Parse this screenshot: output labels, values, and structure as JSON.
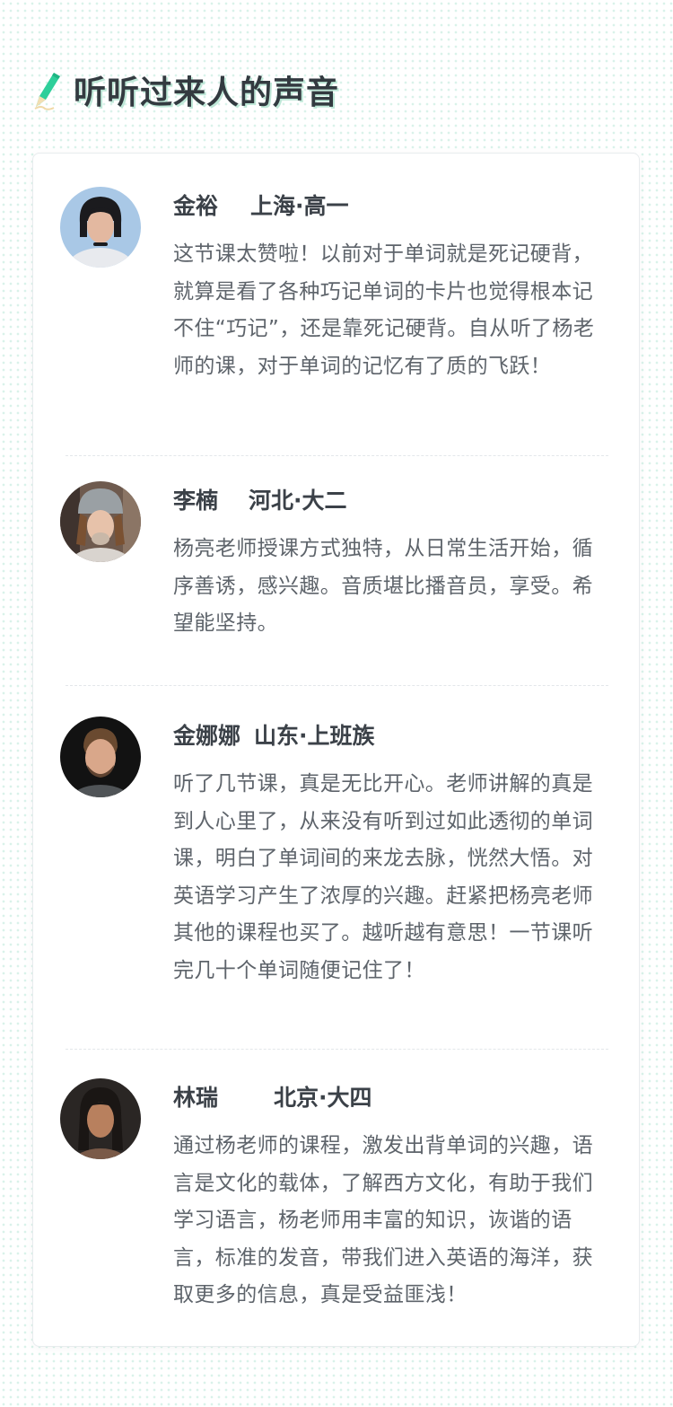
{
  "header": {
    "title": "听听过来人的声音",
    "icon": "pencil-icon"
  },
  "colors": {
    "accent": "#2ecf9a",
    "title_shadow": "#bfe8d8",
    "text": "#5e646b"
  },
  "reviews": [
    {
      "name": "金裕",
      "location": "上海·高一",
      "quote": "这节课太赞啦！以前对于单词就是死记硬背，就算是看了各种巧记单词的卡片也觉得根本记不住“巧记”，还是靠死记硬背。自从听了杨老师的课，对于单词的记忆有了质的飞跃！",
      "avatar": "avatar-photo"
    },
    {
      "name": "李楠",
      "location": "河北·大二",
      "quote": "杨亮老师授课方式独特，从日常生活开始，循序善诱，感兴趣。音质堪比播音员，享受。希望能坚持。",
      "avatar": "avatar-photo"
    },
    {
      "name": "金娜娜",
      "location": "山东·上班族",
      "quote": "听了几节课，真是无比开心。老师讲解的真是到人心里了，从来没有听到过如此透彻的单词课，明白了单词间的来龙去脉，恍然大悟。对英语学习产生了浓厚的兴趣。赶紧把杨亮老师其他的课程也买了。越听越有意思！一节课听完几十个单词随便记住了！",
      "avatar": "avatar-photo"
    },
    {
      "name": "林瑞",
      "location": "北京·大四",
      "quote": "通过杨老师的课程，激发出背单词的兴趣，语言是文化的载体，了解西方文化，有助于我们学习语言，杨老师用丰富的知识，诙谐的语言，标准的发音，带我们进入英语的海洋，获取更多的信息，真是受益匪浅！",
      "avatar": "avatar-photo"
    }
  ]
}
